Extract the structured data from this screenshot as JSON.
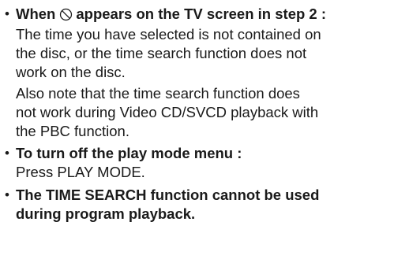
{
  "items": [
    {
      "heading_before_icon": "When",
      "icon": "prohibited-circle-icon",
      "heading_after_icon": "appears on the TV screen in step 2 :",
      "paragraphs": [
        [
          "The time you have selected is not contained on",
          "the disc, or the time search function does not",
          "work on the disc."
        ],
        [
          "Also note that the time search function does",
          "not work during Video CD/SVCD playback with",
          "the PBC function."
        ]
      ]
    },
    {
      "heading": "To turn off the play mode menu :",
      "body": "Press PLAY MODE."
    },
    {
      "heading_lines": [
        "The TIME SEARCH function cannot be used",
        "during program playback."
      ]
    }
  ]
}
